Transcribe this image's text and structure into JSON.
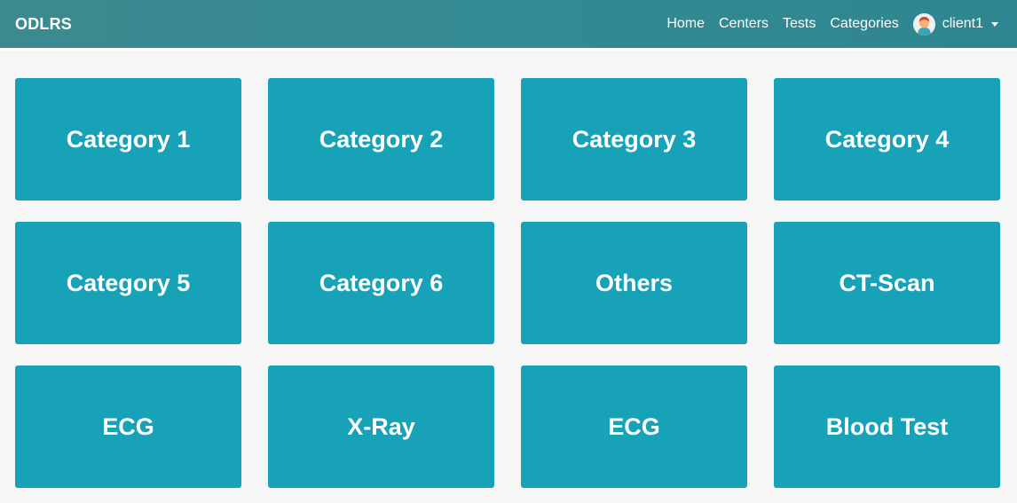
{
  "navbar": {
    "brand": "ODLRS",
    "links": [
      {
        "label": "Home"
      },
      {
        "label": "Centers"
      },
      {
        "label": "Tests"
      },
      {
        "label": "Categories"
      }
    ],
    "user": {
      "name": "client1",
      "avatar_icon": "user-avatar-icon",
      "menu_icon": "caret-down-icon"
    },
    "colors": {
      "background": "#348a92",
      "text": "#ffffff"
    }
  },
  "categories": [
    {
      "label": "Category 1"
    },
    {
      "label": "Category 2"
    },
    {
      "label": "Category 3"
    },
    {
      "label": "Category 4"
    },
    {
      "label": "Category 5"
    },
    {
      "label": "Category 6"
    },
    {
      "label": "Others"
    },
    {
      "label": "CT-Scan"
    },
    {
      "label": "ECG"
    },
    {
      "label": "X-Ray"
    },
    {
      "label": "ECG"
    },
    {
      "label": "Blood Test"
    }
  ],
  "colors": {
    "card": "#17a2b8",
    "page_background": "#f6f6f6"
  }
}
